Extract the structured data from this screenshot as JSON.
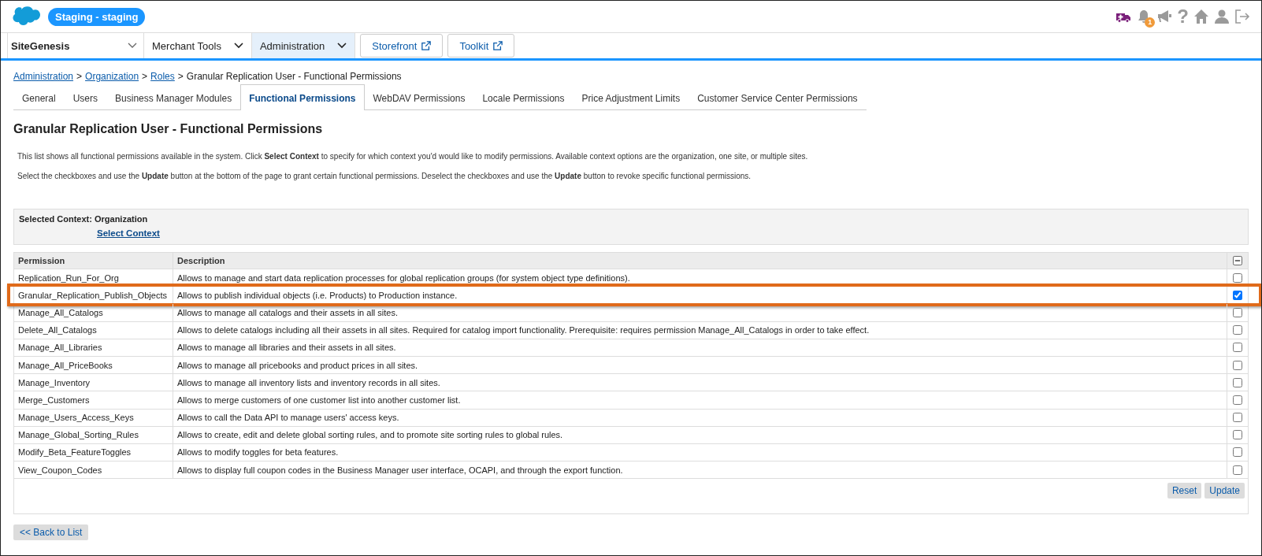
{
  "header": {
    "environment": "Staging - staging",
    "notification_count": "1",
    "help_glyph": "?"
  },
  "nav": {
    "site": "SiteGenesis",
    "menus": [
      {
        "label": "Merchant Tools",
        "selected": false
      },
      {
        "label": "Administration",
        "selected": true
      }
    ],
    "links": [
      "Storefront",
      "Toolkit"
    ]
  },
  "breadcrumb": [
    {
      "kind": "link",
      "label": "Administration"
    },
    {
      "kind": "separator",
      "label": ">"
    },
    {
      "kind": "link",
      "label": "Organization"
    },
    {
      "kind": "separator",
      "label": ">"
    },
    {
      "kind": "link",
      "label": "Roles"
    },
    {
      "kind": "separator",
      "label": ">"
    },
    {
      "kind": "current",
      "label": "Granular Replication User - Functional Permissions"
    }
  ],
  "tabs": [
    {
      "label": "General",
      "selected": false
    },
    {
      "label": "Users",
      "selected": false
    },
    {
      "label": "Business Manager Modules",
      "selected": false
    },
    {
      "label": "Functional Permissions",
      "selected": true
    },
    {
      "label": "WebDAV Permissions",
      "selected": false
    },
    {
      "label": "Locale Permissions",
      "selected": false
    },
    {
      "label": "Price Adjustment Limits",
      "selected": false
    },
    {
      "label": "Customer Service Center Permissions",
      "selected": false
    }
  ],
  "title": "Granular Replication User - Functional Permissions",
  "intro": [
    "This list shows all functional permissions available in the system. Click **Select Context** to specify for which context you'd would like to modify permissions. Available context options are the organization, one site, or multiple sites.",
    "Select the checkboxes and use the **Update** button at the bottom of the page to grant certain functional permissions. Deselect the checkboxes and use the **Update** button to revoke specific functional permissions."
  ],
  "context": {
    "label": "Selected Context: Organization",
    "link": "Select Context"
  },
  "table": {
    "columns": [
      "Permission",
      "Description"
    ],
    "rows": [
      {
        "permission": "Replication_Run_For_Org",
        "description": "Allows to manage and start data replication processes for global replication groups (for system object type definitions).",
        "checked": false,
        "highlighted": false
      },
      {
        "permission": "Granular_Replication_Publish_Objects",
        "description": "Allows to publish individual objects (i.e. Products) to Production instance.",
        "checked": true,
        "highlighted": true
      },
      {
        "permission": "Manage_All_Catalogs",
        "description": "Allows to manage all catalogs and their assets in all sites.",
        "checked": false,
        "highlighted": false
      },
      {
        "permission": "Delete_All_Catalogs",
        "description": "Allows to delete catalogs including all their assets in all sites. Required for catalog import functionality. Prerequisite: requires permission Manage_All_Catalogs in order to take effect.",
        "checked": false,
        "highlighted": false
      },
      {
        "permission": "Manage_All_Libraries",
        "description": "Allows to manage all libraries and their assets in all sites.",
        "checked": false,
        "highlighted": false
      },
      {
        "permission": "Manage_All_PriceBooks",
        "description": "Allows to manage all pricebooks and product prices in all sites.",
        "checked": false,
        "highlighted": false
      },
      {
        "permission": "Manage_Inventory",
        "description": "Allows to manage all inventory lists and inventory records in all sites.",
        "checked": false,
        "highlighted": false
      },
      {
        "permission": "Merge_Customers",
        "description": "Allows to merge customers of one customer list into another customer list.",
        "checked": false,
        "highlighted": false
      },
      {
        "permission": "Manage_Users_Access_Keys",
        "description": "Allows to call the Data API to manage users' access keys.",
        "checked": false,
        "highlighted": false
      },
      {
        "permission": "Manage_Global_Sorting_Rules",
        "description": "Allows to create, edit and delete global sorting rules, and to promote site sorting rules to global rules.",
        "checked": false,
        "highlighted": false
      },
      {
        "permission": "Modify_Beta_FeatureToggles",
        "description": "Allows to modify toggles for beta features.",
        "checked": false,
        "highlighted": false
      },
      {
        "permission": "View_Coupon_Codes",
        "description": "Allows to display full coupon codes in the Business Manager user interface, OCAPI, and through the export function.",
        "checked": false,
        "highlighted": false
      }
    ],
    "buttons": [
      "Reset",
      "Update"
    ]
  },
  "back_button": "<< Back to List"
}
